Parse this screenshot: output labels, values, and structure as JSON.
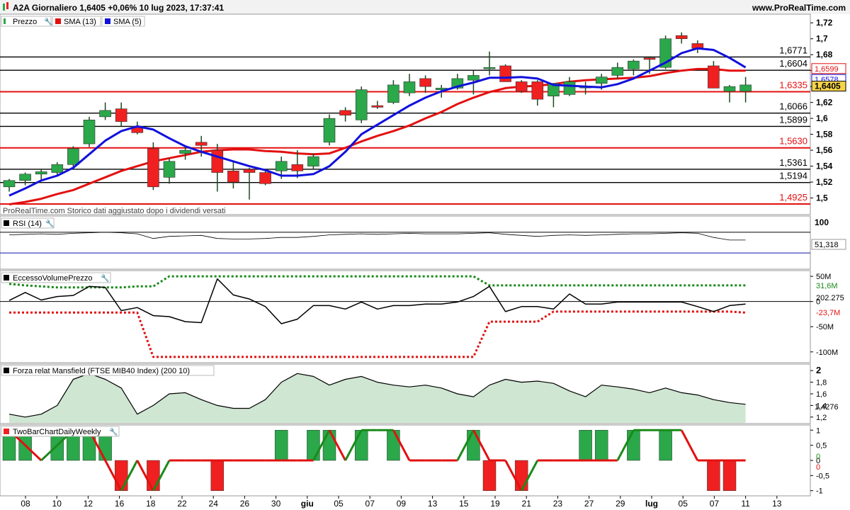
{
  "header": {
    "title": "A2A Giornaliero 1,6405 +0,06% 10 lug 2023, 17:37:41",
    "site": "www.ProRealTime.com"
  },
  "colors": {
    "up": "#2aa84a",
    "down": "#f02020",
    "sma13": "#e31010",
    "sma5": "#1010dd",
    "area": "#cfe6d2",
    "green_line": "#1a8a1a"
  },
  "panels": {
    "price": {
      "legend": [
        {
          "label": "Prezzo",
          "color": "#2aa84a",
          "icon": "candle-icon"
        },
        {
          "label": "SMA (13)",
          "color": "#e31010",
          "icon": "square-icon"
        },
        {
          "label": "SMA (5)",
          "color": "#1010dd",
          "icon": "square-icon"
        }
      ],
      "watermark": "ProRealTime.com Storico dati aggiustato dopo i dividendi versati",
      "ylim": [
        1.48,
        1.73
      ],
      "ticks": [
        "1,72",
        "1,7",
        "1,68",
        "1,66",
        "1,64",
        "1,62",
        "1,6",
        "1,58",
        "1,56",
        "1,54",
        "1,52",
        "1,5"
      ],
      "tick_values": [
        1.72,
        1.7,
        1.68,
        1.66,
        1.64,
        1.62,
        1.6,
        1.58,
        1.56,
        1.54,
        1.52,
        1.5
      ],
      "hlines": [
        {
          "label": "1,6771",
          "value": 1.6771,
          "color": "#000"
        },
        {
          "label": "1,6604",
          "value": 1.6604,
          "color": "#000"
        },
        {
          "label": "1,6335",
          "value": 1.6335,
          "color": "#e31010"
        },
        {
          "label": "1,6066",
          "value": 1.6066,
          "color": "#000"
        },
        {
          "label": "1,5899",
          "value": 1.5899,
          "color": "#000"
        },
        {
          "label": "1,5630",
          "value": 1.563,
          "color": "#e31010"
        },
        {
          "label": "1,5361",
          "value": 1.5361,
          "color": "#000"
        },
        {
          "label": "1,5194",
          "value": 1.5194,
          "color": "#000"
        },
        {
          "label": "1,4925",
          "value": 1.4925,
          "color": "#e31010"
        }
      ],
      "badges": [
        {
          "label": "1,6599",
          "value": 1.6599,
          "color": "#e31010",
          "bold": false
        },
        {
          "label": "1,6578",
          "value": 1.6578,
          "color": "#1010dd",
          "bold": false
        },
        {
          "label": "1,6405",
          "value": 1.6405,
          "color": "#000",
          "bold": true
        }
      ]
    },
    "rsi": {
      "legend": "RSI (14)",
      "tick": "100",
      "value_label": "51,318"
    },
    "eccesso": {
      "legend": "EccessoVolumePrezzo",
      "ticks": [
        "50M",
        "0",
        "-50M",
        "-100M"
      ],
      "tick_values": [
        50,
        0,
        -50,
        -100
      ],
      "badges": [
        "31,6M",
        "202.275",
        "-23,7M"
      ]
    },
    "mansfield": {
      "legend": "Forza relat Mansfield (FTSE MIB40 Index) (200 10)",
      "ticks": [
        "2",
        "1,8",
        "1,6",
        "1,4",
        "1,2"
      ],
      "tick_values": [
        2,
        1.8,
        1.6,
        1.4,
        1.2
      ],
      "badge": "1,4276"
    },
    "twobar": {
      "legend": "TwoBarChartDailyWeekly",
      "ticks": [
        "1",
        "0,5",
        "0",
        "-0,5",
        "-1"
      ],
      "tick_values": [
        1,
        0.5,
        0,
        -0.5,
        -1
      ],
      "badges": [
        "0",
        "0"
      ]
    }
  },
  "x_axis": {
    "labels": [
      "08",
      "10",
      "12",
      "16",
      "18",
      "22",
      "24",
      "26",
      "30",
      "giu",
      "05",
      "07",
      "09",
      "13",
      "15",
      "19",
      "21",
      "23",
      "27",
      "29",
      "lug",
      "05",
      "07",
      "11",
      "13"
    ],
    "bold": [
      "giu",
      "lug"
    ]
  },
  "chart_data": {
    "type": "candlestick",
    "title": "A2A Giornaliero",
    "n": 47,
    "ohlc": [
      [
        1.514,
        1.524,
        1.508,
        1.522
      ],
      [
        1.522,
        1.532,
        1.516,
        1.53
      ],
      [
        1.53,
        1.536,
        1.523,
        1.533
      ],
      [
        1.532,
        1.545,
        1.528,
        1.542
      ],
      [
        1.542,
        1.565,
        1.538,
        1.562
      ],
      [
        1.568,
        1.602,
        1.564,
        1.598
      ],
      [
        1.602,
        1.62,
        1.598,
        1.61
      ],
      [
        1.612,
        1.62,
        1.59,
        1.596
      ],
      [
        1.59,
        1.596,
        1.58,
        1.582
      ],
      [
        1.562,
        1.57,
        1.51,
        1.514
      ],
      [
        1.526,
        1.55,
        1.518,
        1.546
      ],
      [
        1.556,
        1.566,
        1.548,
        1.56
      ],
      [
        1.57,
        1.578,
        1.552,
        1.566
      ],
      [
        1.56,
        1.568,
        1.508,
        1.532
      ],
      [
        1.534,
        1.546,
        1.512,
        1.52
      ],
      [
        1.536,
        1.538,
        1.498,
        1.532
      ],
      [
        1.532,
        1.534,
        1.516,
        1.518
      ],
      [
        1.534,
        1.552,
        1.524,
        1.546
      ],
      [
        1.542,
        1.56,
        1.525,
        1.534
      ],
      [
        1.54,
        1.556,
        1.536,
        1.552
      ],
      [
        1.57,
        1.605,
        1.566,
        1.6
      ],
      [
        1.61,
        1.614,
        1.596,
        1.604
      ],
      [
        1.598,
        1.64,
        1.594,
        1.636
      ],
      [
        1.616,
        1.622,
        1.612,
        1.614
      ],
      [
        1.62,
        1.648,
        1.618,
        1.642
      ],
      [
        1.632,
        1.656,
        1.628,
        1.646
      ],
      [
        1.65,
        1.654,
        1.632,
        1.64
      ],
      [
        1.636,
        1.642,
        1.626,
        1.638
      ],
      [
        1.638,
        1.656,
        1.636,
        1.65
      ],
      [
        1.648,
        1.66,
        1.63,
        1.654
      ],
      [
        1.664,
        1.684,
        1.654,
        1.664
      ],
      [
        1.666,
        1.668,
        1.646,
        1.646
      ],
      [
        1.646,
        1.648,
        1.632,
        1.634
      ],
      [
        1.646,
        1.648,
        1.616,
        1.624
      ],
      [
        1.628,
        1.644,
        1.614,
        1.644
      ],
      [
        1.63,
        1.652,
        1.628,
        1.646
      ],
      [
        1.64,
        1.646,
        1.63,
        1.64
      ],
      [
        1.644,
        1.656,
        1.636,
        1.652
      ],
      [
        1.654,
        1.67,
        1.65,
        1.664
      ],
      [
        1.662,
        1.674,
        1.654,
        1.672
      ],
      [
        1.676,
        1.678,
        1.656,
        1.674
      ],
      [
        1.664,
        1.704,
        1.662,
        1.7
      ],
      [
        1.704,
        1.708,
        1.694,
        1.7
      ],
      [
        1.694,
        1.698,
        1.682,
        1.688
      ],
      [
        1.666,
        1.672,
        1.638,
        1.638
      ],
      [
        1.634,
        1.642,
        1.62,
        1.64
      ],
      [
        1.634,
        1.652,
        1.62,
        1.642
      ]
    ],
    "sma5": [
      1.503,
      1.512,
      1.522,
      1.528,
      1.538,
      1.555,
      1.572,
      1.584,
      1.59,
      1.586,
      1.575,
      1.565,
      1.558,
      1.552,
      1.546,
      1.54,
      1.535,
      1.528,
      1.528,
      1.53,
      1.54,
      1.558,
      1.58,
      1.592,
      1.604,
      1.616,
      1.626,
      1.634,
      1.64,
      1.645,
      1.651,
      1.651,
      1.652,
      1.65,
      1.642,
      1.641,
      1.64,
      1.639,
      1.643,
      1.65,
      1.66,
      1.67,
      1.682,
      1.688,
      1.686,
      1.676,
      1.664
    ],
    "sma13": [
      1.492,
      1.495,
      1.499,
      1.505,
      1.51,
      1.518,
      1.526,
      1.534,
      1.54,
      1.546,
      1.55,
      1.554,
      1.558,
      1.56,
      1.561,
      1.561,
      1.559,
      1.558,
      1.556,
      1.555,
      1.556,
      1.563,
      1.571,
      1.578,
      1.584,
      1.591,
      1.6,
      1.608,
      1.618,
      1.626,
      1.633,
      1.638,
      1.64,
      1.641,
      1.643,
      1.646,
      1.648,
      1.649,
      1.65,
      1.651,
      1.653,
      1.657,
      1.66,
      1.662,
      1.662,
      1.66,
      1.66
    ],
    "rsi": [
      65,
      66,
      67,
      66,
      68,
      69,
      70,
      69,
      67,
      58,
      62,
      63,
      64,
      58,
      57,
      57,
      58,
      60,
      60,
      62,
      65,
      66,
      67,
      66,
      67,
      68,
      67,
      67,
      67,
      68,
      69,
      66,
      64,
      62,
      64,
      65,
      64,
      65,
      66,
      67,
      67,
      68,
      69,
      68,
      60,
      55,
      55
    ],
    "eccesso_line": [
      2,
      18,
      3,
      10,
      12,
      30,
      28,
      -18,
      -12,
      -28,
      -30,
      -40,
      -42,
      45,
      13,
      5,
      -10,
      -44,
      -35,
      -8,
      -8,
      -15,
      -1,
      -15,
      -8,
      -8,
      -5,
      -5,
      -1,
      10,
      30,
      -20,
      -10,
      -10,
      -15,
      15,
      -5,
      -5,
      -1,
      -1,
      -1,
      -1,
      -1,
      -10,
      -20,
      -8,
      -5
    ],
    "eccesso_upper": [
      35,
      32,
      30,
      28,
      28,
      28,
      28,
      28,
      30,
      30,
      50,
      50,
      50,
      50,
      50,
      50,
      50,
      50,
      50,
      50,
      50,
      50,
      50,
      50,
      50,
      50,
      50,
      50,
      50,
      50,
      32,
      32,
      32,
      32,
      32,
      32,
      32,
      32,
      32,
      32,
      32,
      32,
      32,
      32,
      32,
      32,
      32
    ],
    "eccesso_lower": [
      -22,
      -22,
      -22,
      -22,
      -22,
      -22,
      -22,
      -22,
      -22,
      -110,
      -110,
      -110,
      -110,
      -110,
      -110,
      -110,
      -110,
      -110,
      -110,
      -110,
      -110,
      -110,
      -110,
      -110,
      -110,
      -110,
      -110,
      -110,
      -110,
      -110,
      -40,
      -40,
      -40,
      -40,
      -20,
      -20,
      -20,
      -20,
      -20,
      -20,
      -20,
      -20,
      -20,
      -20,
      -20,
      -20,
      -22
    ],
    "mansfield": [
      1.25,
      1.2,
      1.25,
      1.4,
      1.85,
      1.95,
      1.85,
      1.7,
      1.25,
      1.4,
      1.6,
      1.62,
      1.5,
      1.4,
      1.35,
      1.35,
      1.5,
      1.8,
      1.95,
      1.9,
      1.75,
      1.85,
      1.9,
      1.8,
      1.75,
      1.72,
      1.75,
      1.7,
      1.6,
      1.55,
      1.75,
      1.85,
      1.8,
      1.82,
      1.78,
      1.65,
      1.55,
      1.75,
      1.72,
      1.68,
      1.62,
      1.7,
      1.62,
      1.58,
      1.5,
      1.45,
      1.42
    ],
    "twobar_bars": [
      1,
      1,
      0,
      1,
      1,
      1,
      1,
      -1,
      0,
      -1,
      0,
      0,
      0,
      -1,
      0,
      0,
      0,
      1,
      0,
      1,
      1,
      0,
      1,
      0,
      1,
      0,
      0,
      0,
      0,
      1,
      -1,
      0,
      -1,
      0,
      0,
      0,
      1,
      1,
      0,
      1,
      0,
      1,
      0,
      0,
      -1,
      -1,
      0
    ],
    "twobar_line": [
      1,
      0.5,
      0,
      0.5,
      1,
      1,
      0,
      -1,
      0,
      -1,
      0,
      0,
      0,
      0,
      0,
      0,
      0,
      0,
      0,
      0,
      1,
      0,
      1,
      1,
      1,
      0,
      0,
      0,
      0,
      1,
      0,
      0,
      -1,
      0,
      0,
      0,
      0,
      0,
      0,
      1,
      1,
      1,
      1,
      0,
      0,
      0,
      0
    ]
  }
}
